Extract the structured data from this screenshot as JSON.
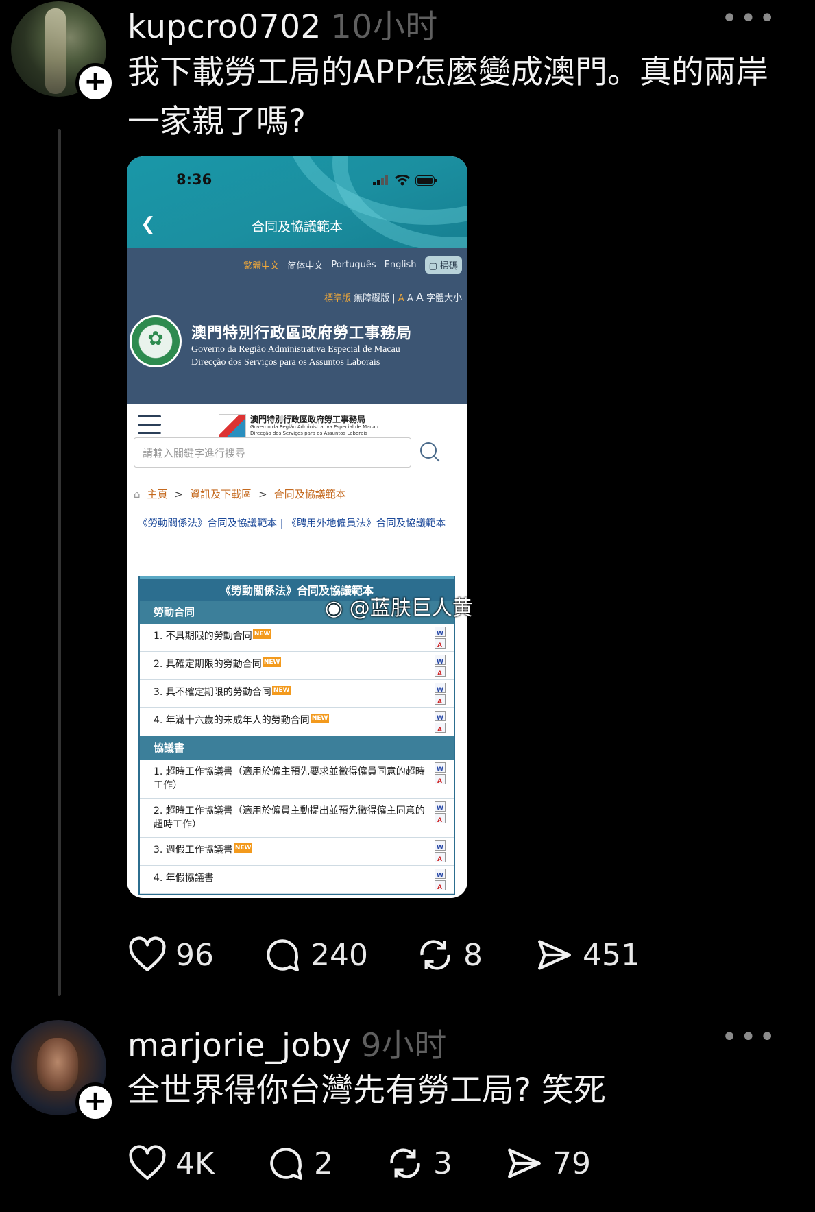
{
  "post1": {
    "username": "kupcro0702",
    "time": "10小时",
    "text_line1": "我下載勞工局的APP怎麼變成澳門。真的兩岸",
    "text_line2": "一家親了嗎?",
    "likes": "96",
    "comments": "240",
    "reposts": "8",
    "shares": "451"
  },
  "post2": {
    "username": "marjorie_joby",
    "time": "9小时",
    "text": "全世界得你台灣先有勞工局?  笑死",
    "likes": "4K",
    "comments": "2",
    "reposts": "3",
    "shares": "79"
  },
  "screenshot": {
    "clock": "8:36",
    "page_title": "合同及協議範本",
    "languages": [
      "繁體中文",
      "简体中文",
      "Português",
      "English"
    ],
    "scan_label": "掃碼",
    "access": {
      "standard": "標準版",
      "accessible": "無障礙版",
      "sep": "|",
      "font_a1": "A",
      "font_a2": "A",
      "font_a3": "A",
      "font_label": "字體大小"
    },
    "dept_zh": "澳門特別行政區政府勞工事務局",
    "dept_pt1": "Governo da Região Administrativa Especial de Macau",
    "dept_pt2": "Direcção dos Serviços para os Assuntos Laborais",
    "nav_logo_zh": "澳門特別行政區政府勞工事務局",
    "nav_logo_pt1": "Governo da Região Administrativa Especial de Macau",
    "nav_logo_pt2": "Direcção dos Serviços para os Assuntos Laborais",
    "search_placeholder": "請輸入關鍵字進行搜尋",
    "breadcrumb": [
      "主頁",
      "資訊及下載區",
      "合同及協議範本"
    ],
    "law_links": "《勞動關係法》合同及協議範本 | 《聘用外地僱員法》合同及協議範本",
    "table_title": "《勞動關係法》合同及協議範本",
    "section1": "勞動合同",
    "contracts": [
      "1. 不具期限的勞動合同",
      "2. 具確定期限的勞動合同",
      "3. 具不確定期限的勞動合同",
      "4. 年滿十六歲的未成年人的勞動合同"
    ],
    "new_tag": "NEW",
    "section2": "協議書",
    "agreements": [
      "1. 超時工作協議書（適用於僱主預先要求並徵得僱員同意的超時工作）",
      "2. 超時工作協議書（適用於僱員主動提出並預先徵得僱主同意的超時工作）",
      "3. 週假工作協議書",
      "4. 年假協議書"
    ],
    "watermark": "@蓝肤巨人黄"
  }
}
